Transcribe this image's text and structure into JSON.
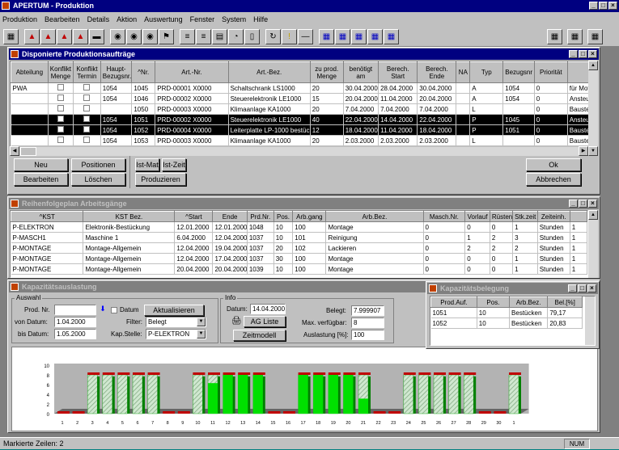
{
  "app": {
    "title": "APERTUM - Produktion",
    "status_text": "Markierte Zeilen: 2",
    "status_num": "NUM"
  },
  "menu": [
    "Produktion",
    "Bearbeiten",
    "Details",
    "Aktion",
    "Auswertung",
    "Fenster",
    "System",
    "Hilfe"
  ],
  "w1": {
    "title": "Disponierte Produktionsaufträge",
    "headers": [
      "Abteilung",
      "Konflikt Menge",
      "Konflikt Termin",
      "Haupt-Bezugsnr.",
      "^Nr.",
      "Art.-Nr.",
      "Art.-Bez.",
      "zu prod. Menge",
      "benötigt am",
      "Berech. Start",
      "Berech. Ende",
      "NA",
      "Typ",
      "Bezugsnr",
      "Priorität",
      ""
    ],
    "rows": [
      [
        "PWA",
        "",
        "",
        "1054",
        "1045",
        "PRD-00001 X0000",
        "Schaltschrank LS1000",
        "20",
        "30.04.2000",
        "28.04.2000",
        "30.04.2000",
        "",
        "A",
        "1054",
        "0",
        "für Mote"
      ],
      [
        "",
        "",
        "",
        "1054",
        "1046",
        "PRD-00002 X0000",
        "Steuerelektronik LE1000",
        "15",
        "20.04.2000",
        "11.04.2000",
        "20.04.2000",
        "",
        "A",
        "1054",
        "0",
        "Ansteue"
      ],
      [
        "",
        "",
        "",
        "",
        "1050",
        "PRD-00003 X0000",
        "Klimaanlage KA1000",
        "20",
        "7.04.2000",
        "7.04.2000",
        "7.04.2000",
        "",
        "L",
        "",
        "0",
        "Bauster"
      ],
      [
        "",
        "",
        "",
        "1054",
        "1051",
        "PRD-00002 X0000",
        "Steuerelektronik LE1000",
        "40",
        "22.04.2000",
        "14.04.2000",
        "22.04.2000",
        "",
        "P",
        "1045",
        "0",
        "Ansteue"
      ],
      [
        "",
        "",
        "",
        "1054",
        "1052",
        "PRD-00004 X0000",
        "Leiterplatte LP-1000 bestückt",
        "12",
        "18.04.2000",
        "11.04.2000",
        "18.04.2000",
        "",
        "P",
        "1051",
        "0",
        "Bauster"
      ],
      [
        "",
        "",
        "",
        "1054",
        "1053",
        "PRD-00003 X0000",
        "Klimaanlage KA1000",
        "20",
        "2.03.2000",
        "2.03.2000",
        "2.03.2000",
        "",
        "L",
        "",
        "0",
        "Bauster"
      ]
    ],
    "buttons": {
      "neu": "Neu",
      "bearbeiten": "Bearbeiten",
      "positionen": "Positionen",
      "loeschen": "Löschen",
      "istmat": "Ist-Mat",
      "istzeit": "Ist-Zeit",
      "produzieren": "Produzieren",
      "ok": "Ok",
      "abbrechen": "Abbrechen"
    }
  },
  "w2": {
    "title": "Reihenfolgeplan Arbeitsgänge",
    "headers": [
      "^KST",
      "KST Bez.",
      "^Start",
      "Ende",
      "Prd.Nr.",
      "Pos.",
      "Arb.gang",
      "Arb.Bez.",
      "Masch.Nr.",
      "Vorlauf",
      "Rüsten",
      "Stk.zeit",
      "Zeiteinh.",
      ""
    ],
    "rows": [
      [
        "P-ELEKTRON",
        "Elektronik-Bestückung",
        "12.01.2000",
        "12.01.2000",
        "1048",
        "10",
        "100",
        "Montage",
        "0",
        "0",
        "0",
        "1",
        "Stunden",
        "1"
      ],
      [
        "P-MASCH1",
        "Maschine 1",
        "6.04.2000",
        "12.04.2000",
        "1037",
        "10",
        "101",
        "Reinigung",
        "0",
        "1",
        "2",
        "3",
        "Stunden",
        "1"
      ],
      [
        "P-MONTAGE",
        "Montage-Allgemein",
        "12.04.2000",
        "19.04.2000",
        "1037",
        "20",
        "102",
        "Lackieren",
        "0",
        "2",
        "2",
        "2",
        "Stunden",
        "1"
      ],
      [
        "P-MONTAGE",
        "Montage-Allgemein",
        "12.04.2000",
        "17.04.2000",
        "1037",
        "30",
        "100",
        "Montage",
        "0",
        "0",
        "0",
        "1",
        "Stunden",
        "1"
      ],
      [
        "P-MONTAGE",
        "Montage-Allgemein",
        "20.04.2000",
        "20.04.2000",
        "1039",
        "10",
        "100",
        "Montage",
        "0",
        "0",
        "0",
        "1",
        "Stunden",
        "1"
      ]
    ]
  },
  "w3": {
    "title": "Kapazitätsauslastung",
    "auswahl": "Auswahl",
    "info": "Info",
    "prodnr_label": "Prod. Nr.",
    "prodnr": "",
    "datum_chk": "Datum",
    "aktualisieren": "Aktualisieren",
    "vondatum_label": "von Datum:",
    "vondatum": "1.04.2000",
    "bisdatum_label": "bis Datum:",
    "bisdatum": "1.05.2000",
    "filter_label": "Filter:",
    "filter": "Belegt",
    "kapstelle_label": "Kap.Stelle:",
    "kapstelle": "P-ELEKTRON",
    "datum_label": "Datum:",
    "datum": "14.04.2000",
    "agliste": "AG Liste",
    "zeitmodell": "Zeitmodell",
    "belegt_label": "Belegt:",
    "belegt": "7.999907",
    "maxverf_label": "Max. verfügbar:",
    "maxverf": "8",
    "auslastung_label": "Auslastung [%]:",
    "auslastung": "100"
  },
  "w4": {
    "title": "Kapazitätsbelegung",
    "headers": [
      "Prod.Auf.",
      "Pos.",
      "Arb.Bez.",
      "Bel.[%]"
    ],
    "rows": [
      [
        "1051",
        "10",
        "Bestücken",
        "79,17"
      ],
      [
        "1052",
        "10",
        "Bestücken",
        "20,83"
      ]
    ]
  },
  "chart_data": {
    "type": "bar",
    "ylim": [
      0,
      10
    ],
    "yticks": [
      "0",
      "2",
      "4",
      "6",
      "8",
      "10"
    ],
    "categories": [
      "1",
      "2",
      "3",
      "4",
      "5",
      "6",
      "7",
      "8",
      "9",
      "10",
      "11",
      "12",
      "13",
      "14",
      "15",
      "16",
      "17",
      "18",
      "19",
      "20",
      "21",
      "22",
      "23",
      "24",
      "25",
      "26",
      "27",
      "28",
      "29",
      "30",
      "1"
    ],
    "values": [
      0,
      0,
      8,
      8,
      8,
      8,
      8,
      0,
      0,
      8,
      8,
      8,
      8,
      8,
      0,
      0,
      8,
      8,
      8,
      8,
      8,
      0,
      0,
      8,
      8,
      8,
      8,
      8,
      0,
      0,
      8
    ],
    "series_fill": [
      0,
      0,
      0,
      0,
      0,
      0,
      0,
      0,
      0,
      0,
      6.3,
      8,
      8,
      8,
      0,
      0,
      8,
      8,
      8,
      8,
      3.1,
      0,
      0,
      0,
      0,
      0,
      0,
      0,
      0,
      0,
      0
    ],
    "colors": {
      "bar": "#b8dcb8",
      "fill": "#00e000",
      "capped": "#c00000"
    }
  }
}
